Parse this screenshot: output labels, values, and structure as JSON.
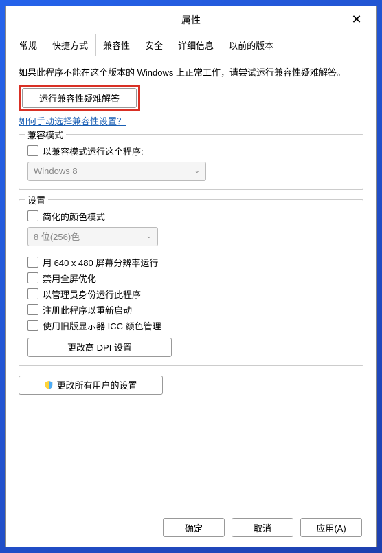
{
  "titlebar": {
    "title": "属性"
  },
  "tabs": {
    "general": "常规",
    "shortcut": "快捷方式",
    "compatibility": "兼容性",
    "security": "安全",
    "details": "详细信息",
    "previous": "以前的版本"
  },
  "intro": {
    "line1": "如果此程序不能在这个版本的 Windows 上正常工作，请尝试运行兼容性疑难解答。"
  },
  "buttons": {
    "troubleshoot": "运行兼容性疑难解答",
    "manual_link": "如何手动选择兼容性设置？",
    "dpi": "更改高 DPI 设置",
    "all_users": "更改所有用户的设置",
    "ok": "确定",
    "cancel": "取消",
    "apply": "应用(A)"
  },
  "compat_mode": {
    "title": "兼容模式",
    "checkbox": "以兼容模式运行这个程序:",
    "selected": "Windows 8"
  },
  "settings": {
    "title": "设置",
    "reduced_color": "简化的颜色模式",
    "color_selected": "8 位(256)色",
    "resolution": "用 640 x 480 屏幕分辨率运行",
    "disable_fullscreen": "禁用全屏优化",
    "run_admin": "以管理员身份运行此程序",
    "register_restart": "注册此程序以重新启动",
    "legacy_icc": "使用旧版显示器 ICC 颜色管理"
  }
}
